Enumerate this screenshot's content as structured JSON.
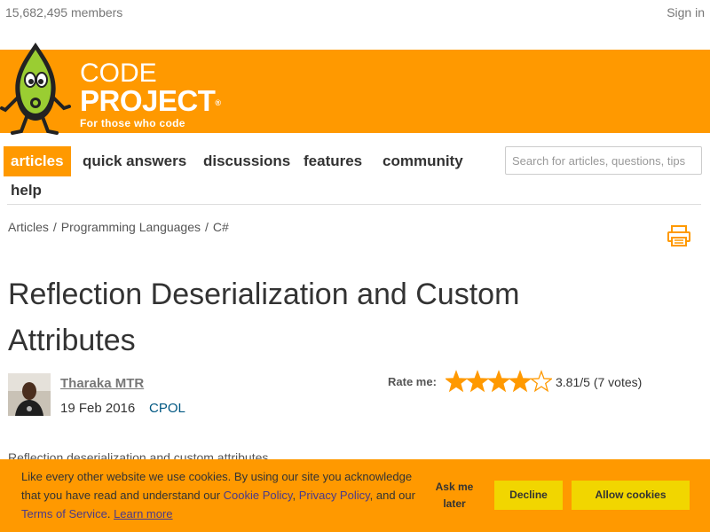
{
  "topbar": {
    "members": "15,682,495 members",
    "signin": "Sign in"
  },
  "brand": {
    "line1": "CODE",
    "line2": "PROJECT",
    "reg": "®",
    "tagline": "For those who code"
  },
  "colors": {
    "brand_orange": "#ff9900",
    "cookie_button": "#f1d600",
    "link_blue": "#005782"
  },
  "nav": {
    "items": [
      {
        "label": "articles",
        "active": true
      },
      {
        "label": "quick answers"
      },
      {
        "label": "discussions"
      },
      {
        "label": "features"
      },
      {
        "label": "community"
      },
      {
        "label": "help"
      }
    ],
    "search_placeholder": "Search for articles, questions, tips"
  },
  "breadcrumb": {
    "items": [
      "Articles",
      "Programming Languages",
      "C#"
    ],
    "separator": "/"
  },
  "article": {
    "title": "Reflection Deserialization and Custom Attributes",
    "author": "Tharaka MTR",
    "date": "19 Feb 2016",
    "license": "CPOL",
    "summary": "Reflection deserialization and custom attributes"
  },
  "rating": {
    "label": "Rate me:",
    "value": 3.81,
    "max": 5,
    "text": "3.81/5 (7 votes)",
    "stars_filled": 4
  },
  "icons": {
    "print": "print-icon",
    "mascot": "bob-mascot-logo",
    "avatar": "author-avatar"
  },
  "cookie": {
    "text_before": "Like every other website we use cookies. By using our site you acknowledge that you have read and understand our ",
    "cookie_policy": "Cookie Policy",
    "comma": ", ",
    "privacy_policy": "Privacy Policy",
    "and_our": ", and our ",
    "terms": "Terms of Service",
    "period": ".",
    "learn_more": "Learn more",
    "ask_later": "Ask me later",
    "decline": "Decline",
    "allow": "Allow cookies"
  }
}
